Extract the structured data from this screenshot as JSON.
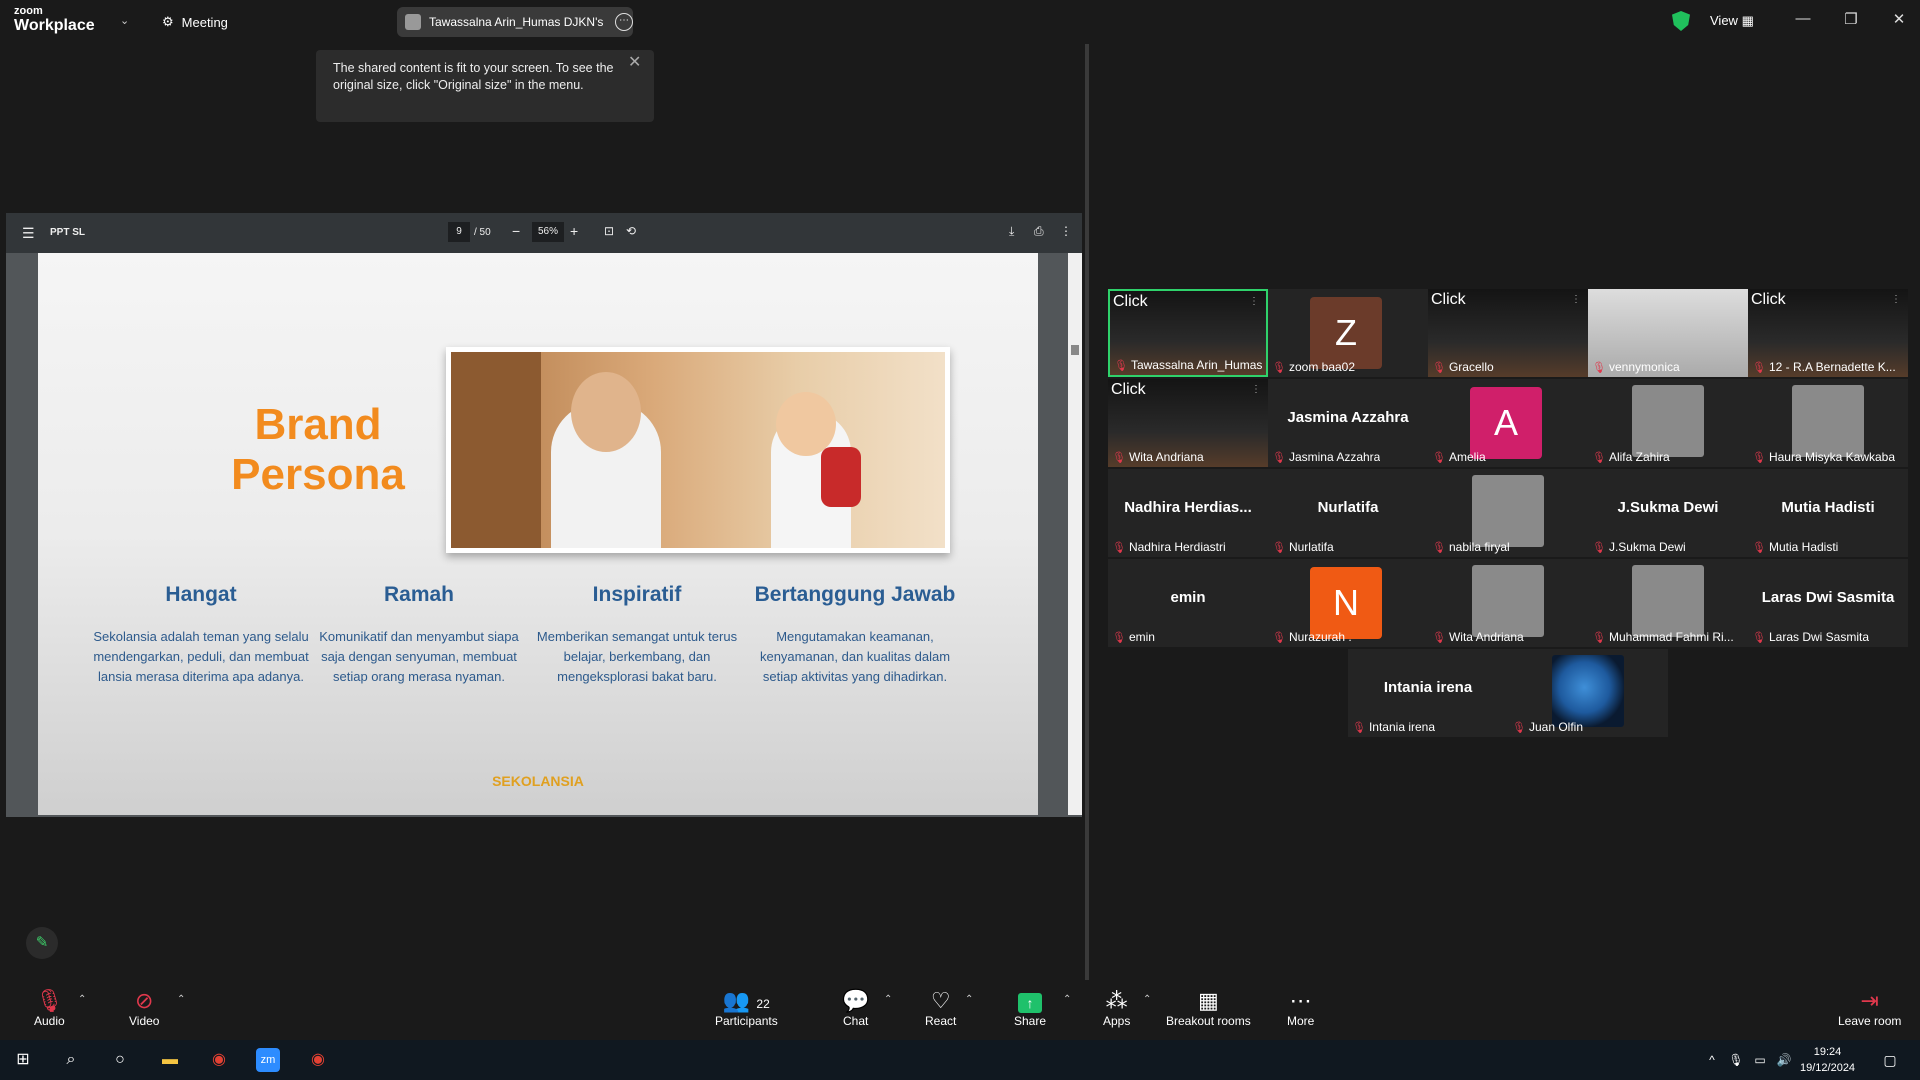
{
  "app": {
    "brand_small": "zoom",
    "brand_big": "Workplace",
    "meeting_label": "Meeting",
    "share_tab": "Tawassalna Arin_Humas DJKN's s",
    "view_label": "View"
  },
  "tooltip": {
    "text": "The shared content is fit to your screen. To see the original size, click \"Original size\" in the menu."
  },
  "pdf": {
    "title": "PPT SL",
    "page": "9",
    "total": "/ 50",
    "zoom": "56%"
  },
  "slide": {
    "brand_line1": "Brand",
    "brand_line2": "Persona",
    "logo": "SEKOLANSIA",
    "columns": [
      {
        "title": "Hangat",
        "text": "Sekolansia adalah teman yang selalu mendengarkan, peduli, dan membuat lansia merasa diterima apa adanya."
      },
      {
        "title": "Ramah",
        "text": "Komunikatif dan menyambut siapa saja dengan senyuman, membuat setiap orang merasa nyaman."
      },
      {
        "title": "Inspiratif",
        "text": "Memberikan semangat untuk terus belajar, berkembang, dan mengeksplorasi bakat baru."
      },
      {
        "title": "Bertanggung Jawab",
        "text": "Mengutamakan keamanan, kenyamanan, dan kualitas dalam setiap aktivitas yang dihadirkan."
      }
    ]
  },
  "participants": [
    {
      "name": "Tawassalna Arin_Humas ...",
      "kind": "click",
      "active": true
    },
    {
      "name": "zoom baa02",
      "kind": "avatar",
      "letter": "Z",
      "color": "#6b3b2a"
    },
    {
      "name": "Gracello",
      "kind": "click"
    },
    {
      "name": "vennymonica",
      "kind": "cam"
    },
    {
      "name": "12 - R.A Bernadette K...",
      "kind": "click"
    },
    {
      "name": "Wita Andriana",
      "kind": "click"
    },
    {
      "name": "Jasmina Azzahra",
      "kind": "text",
      "big": "Jasmina Azzahra"
    },
    {
      "name": "Amelia",
      "kind": "avatar",
      "letter": "A",
      "color": "#d01f6a"
    },
    {
      "name": "Alifa Zahira",
      "kind": "photo"
    },
    {
      "name": "Haura Misyka Kawkaba",
      "kind": "photo"
    },
    {
      "name": "Nadhira Herdiastri",
      "kind": "text",
      "big": "Nadhira  Herdias..."
    },
    {
      "name": "Nurlatifa",
      "kind": "text",
      "big": "Nurlatifa"
    },
    {
      "name": "nabila firyal",
      "kind": "photo"
    },
    {
      "name": "J.Sukma Dewi",
      "kind": "text",
      "big": "J.Sukma Dewi"
    },
    {
      "name": "Mutia Hadisti",
      "kind": "text",
      "big": "Mutia Hadisti"
    },
    {
      "name": "emin",
      "kind": "text",
      "big": "emin"
    },
    {
      "name": "Nurazurah .",
      "kind": "avatar",
      "letter": "N",
      "color": "#f05a14"
    },
    {
      "name": "Wita Andriana",
      "kind": "photo"
    },
    {
      "name": "Muhammad Fahmi Ri...",
      "kind": "photo"
    },
    {
      "name": "Laras Dwi Sasmita",
      "kind": "text",
      "big": "Laras Dwi Sasmita"
    },
    {
      "name": "Intania irena",
      "kind": "text",
      "big": "Intania irena"
    },
    {
      "name": "Juan Olfin",
      "kind": "globe"
    }
  ],
  "toolbar": {
    "audio": "Audio",
    "video": "Video",
    "participants": "Participants",
    "participant_count": "22",
    "chat": "Chat",
    "react": "React",
    "share": "Share",
    "apps": "Apps",
    "breakout": "Breakout rooms",
    "more": "More",
    "leave": "Leave room"
  },
  "clock": {
    "time": "19:24",
    "date": "19/12/2024"
  },
  "icons": {
    "shield": "shield-check-icon",
    "share_color": "#1fc16b",
    "mute_color": "#e0384c"
  }
}
